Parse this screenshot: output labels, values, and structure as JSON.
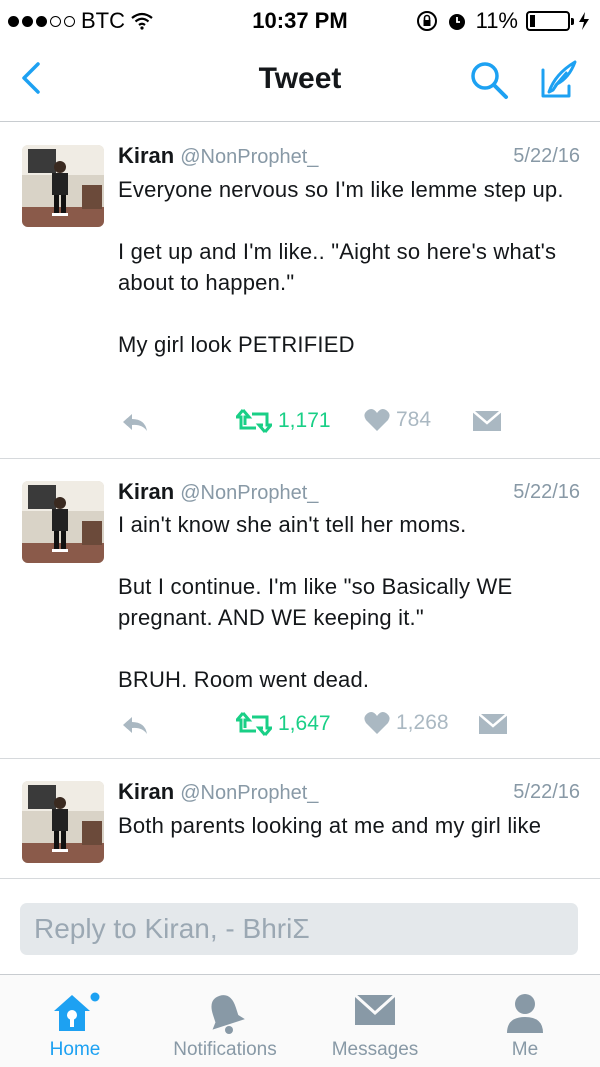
{
  "status_bar": {
    "carrier": "BTC",
    "time": "10:37 PM",
    "battery": "11%",
    "signal_bars_filled": 3,
    "signal_bars_total": 5
  },
  "nav": {
    "title": "Tweet",
    "back_icon": "chevron-left-icon",
    "search_icon": "search-icon",
    "compose_icon": "compose-icon"
  },
  "tweets": [
    {
      "name": "Kiran",
      "handle": "@NonProphet_",
      "date": "5/22/16",
      "text": "Everyone nervous so I'm like lemme step up.\n\nI get up and I'm like.. \"Aight so here's what's about to happen.\"\n\nMy girl look PETRIFIED",
      "retweets": "1,171",
      "likes": "784"
    },
    {
      "name": "Kiran",
      "handle": "@NonProphet_",
      "date": "5/22/16",
      "text": "I ain't know she ain't tell her moms.\n\nBut I continue. I'm like \"so Basically WE pregnant. AND WE keeping it.\"\n\nBRUH. Room went dead.",
      "retweets": "1,647",
      "likes": "1,268"
    },
    {
      "name": "Kiran",
      "handle": "@NonProphet_",
      "date": "5/22/16",
      "text": "Both parents looking at me and my girl like"
    }
  ],
  "reply": {
    "placeholder": "Reply to Kiran, - BhriΣ"
  },
  "tabs": [
    {
      "label": "Home",
      "icon": "home-icon",
      "active": true
    },
    {
      "label": "Notifications",
      "icon": "bell-icon",
      "active": false
    },
    {
      "label": "Messages",
      "icon": "envelope-icon",
      "active": false
    },
    {
      "label": "Me",
      "icon": "person-icon",
      "active": false
    }
  ],
  "colors": {
    "accent": "#1da1f2",
    "retweet_green": "#19cf86",
    "muted": "#8899a6",
    "like_grey": "#aab8c2"
  }
}
